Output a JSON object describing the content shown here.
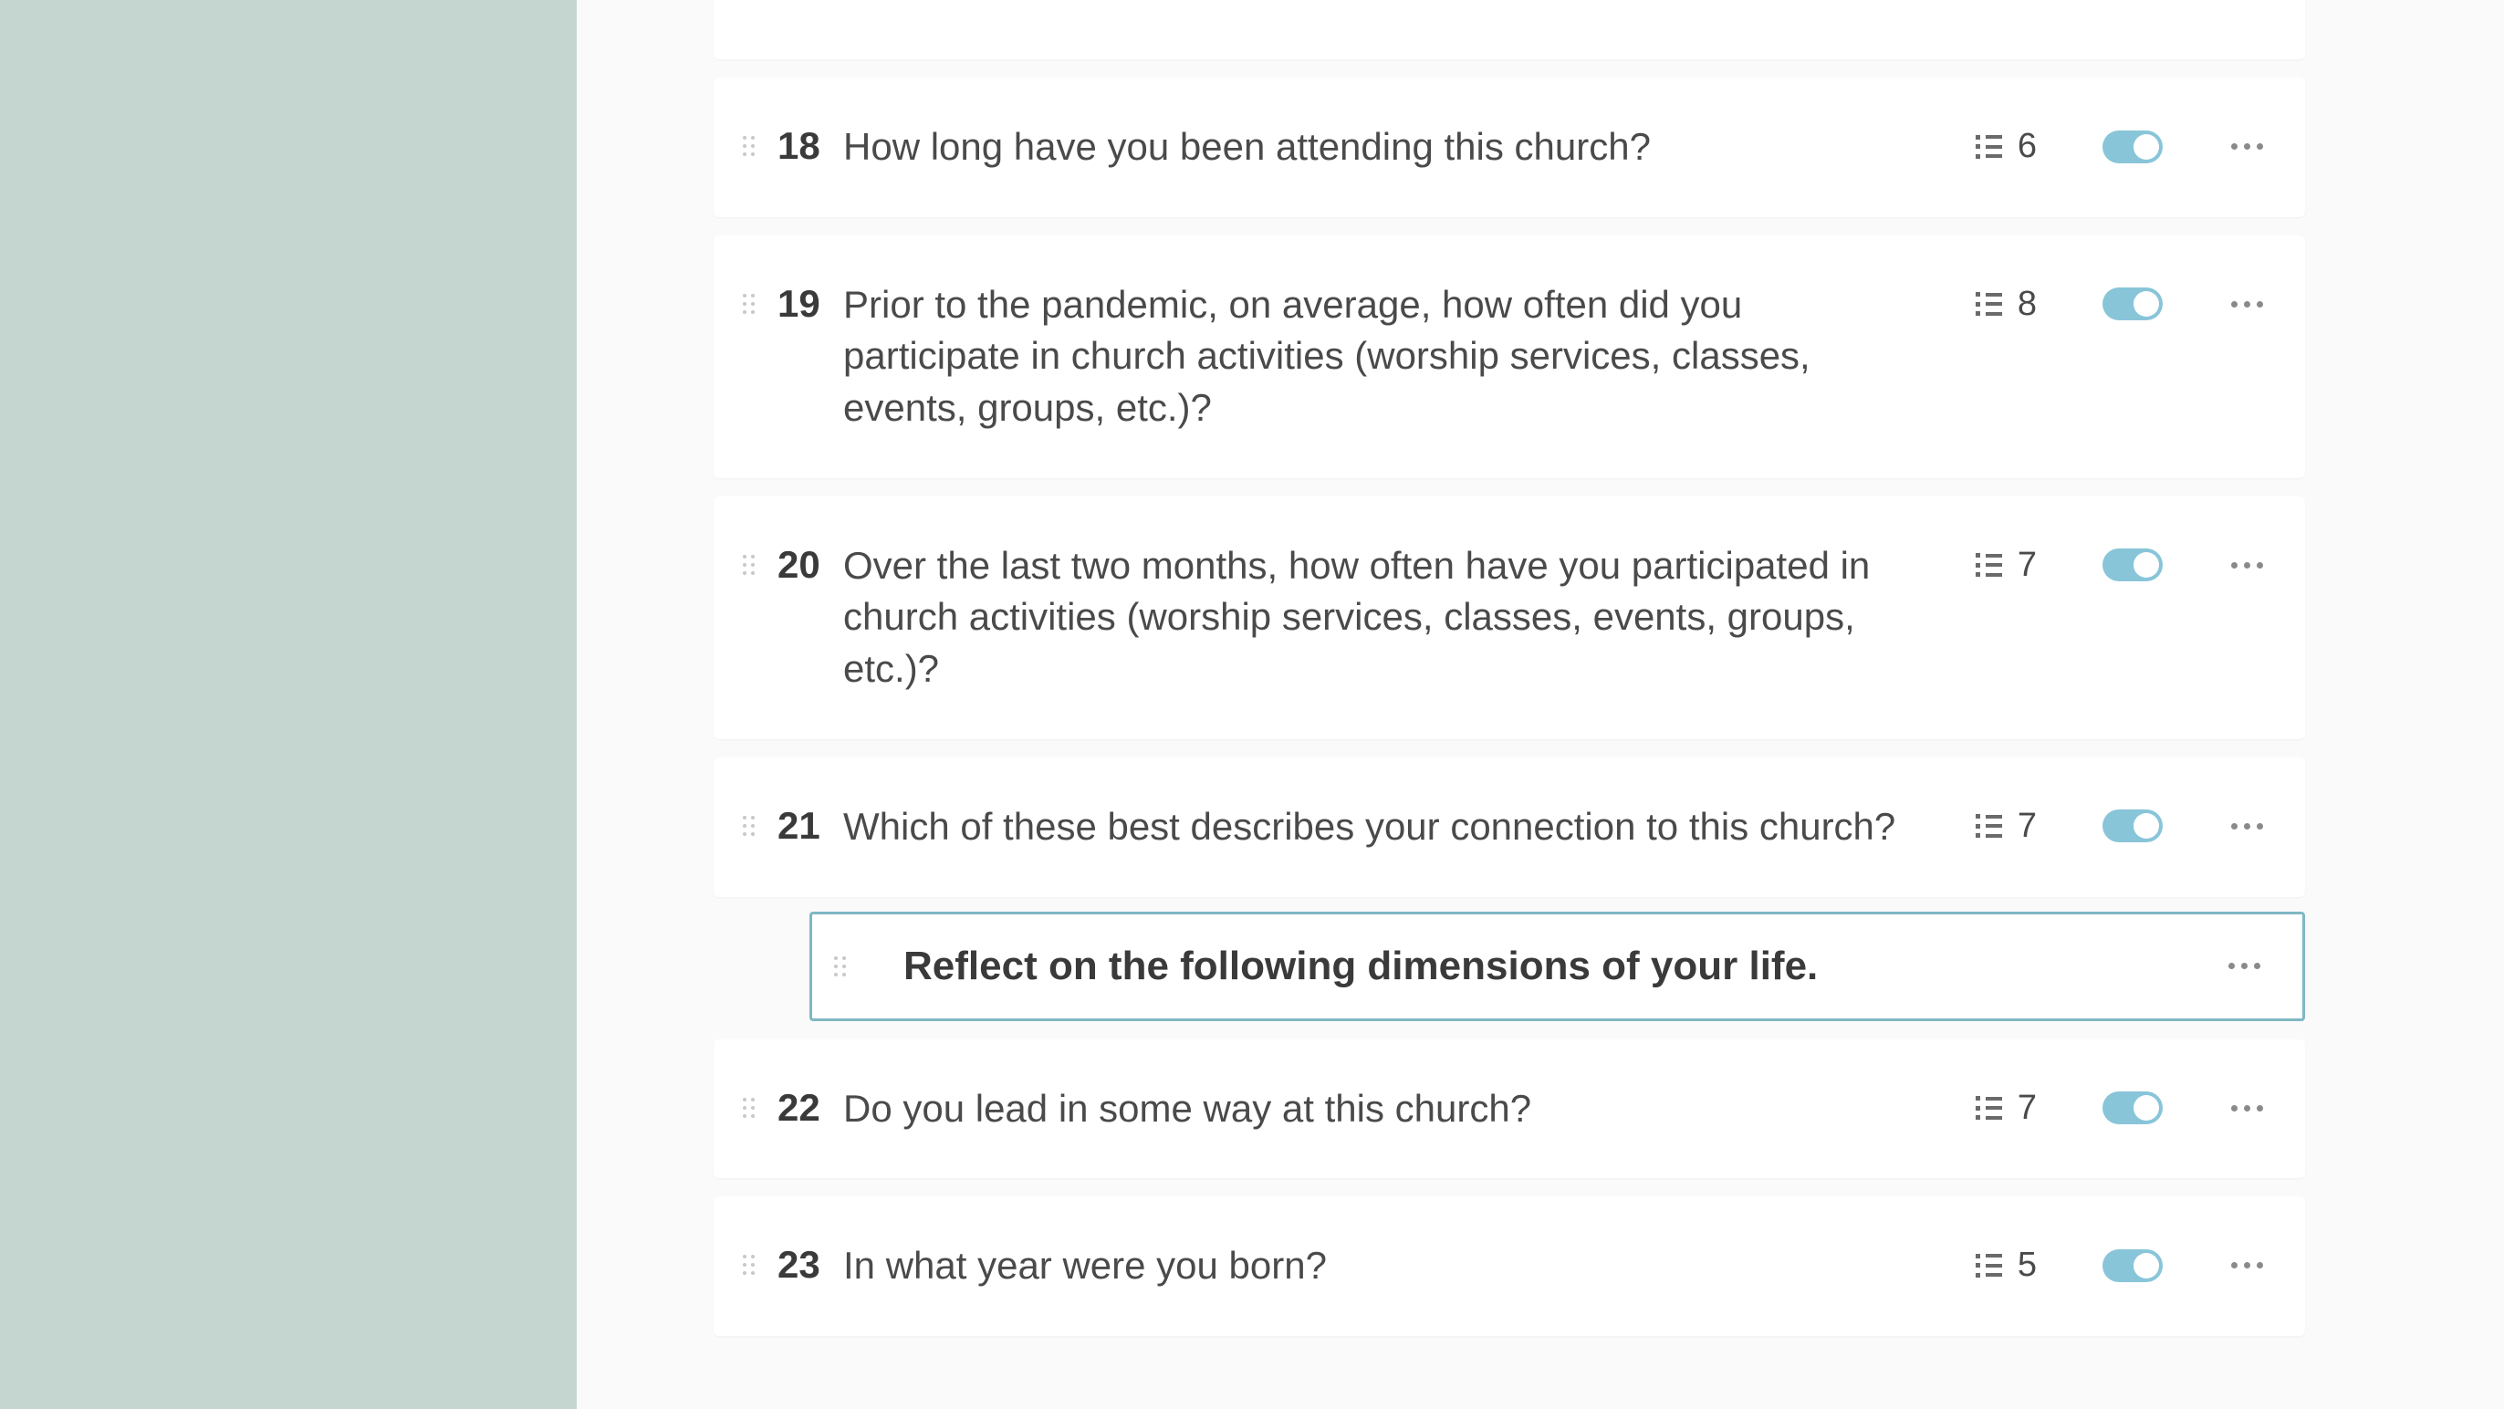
{
  "questions": [
    {
      "number": "18",
      "text": "How long have you been attending this church?",
      "options": "6"
    },
    {
      "number": "19",
      "text": "Prior to the pandemic, on average, how often did you participate in church activities (worship services, classes, events, groups, etc.)?",
      "options": "8"
    },
    {
      "number": "20",
      "text": "Over the last two months, how often have you participated in church activities (worship services, classes, events, groups, etc.)?",
      "options": "7"
    },
    {
      "number": "21",
      "text": "Which of these best describes your connection to this church?",
      "options": "7"
    },
    {
      "number": "22",
      "text": "Do you lead in some way at this church?",
      "options": "7"
    },
    {
      "number": "23",
      "text": "In what year were you born?",
      "options": "5"
    }
  ],
  "section": {
    "title": "Reflect on the following dimensions of your life."
  }
}
